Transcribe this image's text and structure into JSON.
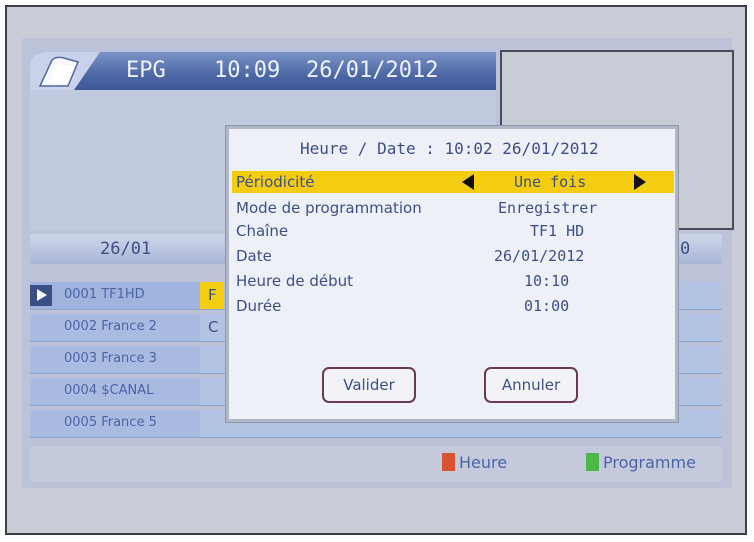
{
  "header": {
    "section": "EPG",
    "time": "10:09",
    "date": "26/01/2012"
  },
  "day_column": {
    "date": "26/01",
    "right_label": "0"
  },
  "channels": [
    {
      "name": "0001 TF1HD",
      "selected": true,
      "program": "F"
    },
    {
      "name": "0002 France 2",
      "selected": false,
      "program": "C"
    },
    {
      "name": "0003 France 3",
      "selected": false,
      "program": ""
    },
    {
      "name": "0004 $CANAL",
      "selected": false,
      "program": ""
    },
    {
      "name": "0005 France 5",
      "selected": false,
      "program": ""
    }
  ],
  "legend": {
    "heure": {
      "label": "Heure",
      "color": "#d9532c"
    },
    "programme": {
      "label": "Programme",
      "color": "#4cb848"
    }
  },
  "dialog": {
    "title": "Heure / Date : 10:02  26/01/2012",
    "rows": [
      {
        "label": "Périodicité",
        "value": "Une fois"
      },
      {
        "label": "Mode de programmation",
        "value": "Enregistrer"
      },
      {
        "label": "Chaîne",
        "value": "TF1 HD"
      },
      {
        "label": "Date",
        "value": "26/01/2012"
      },
      {
        "label": "Heure de début",
        "value": "10:10"
      },
      {
        "label": "Durée",
        "value": "01:00"
      }
    ],
    "confirm_label": "Valider",
    "cancel_label": "Annuler"
  },
  "colors": {
    "highlight": "#f4cc10",
    "header_bar": "#4e68a6",
    "text": "#3d4f86"
  },
  "icons": {
    "header": "folder-icon",
    "play": "play-arrow-icon",
    "left": "arrow-left-icon",
    "right": "arrow-right-icon"
  }
}
